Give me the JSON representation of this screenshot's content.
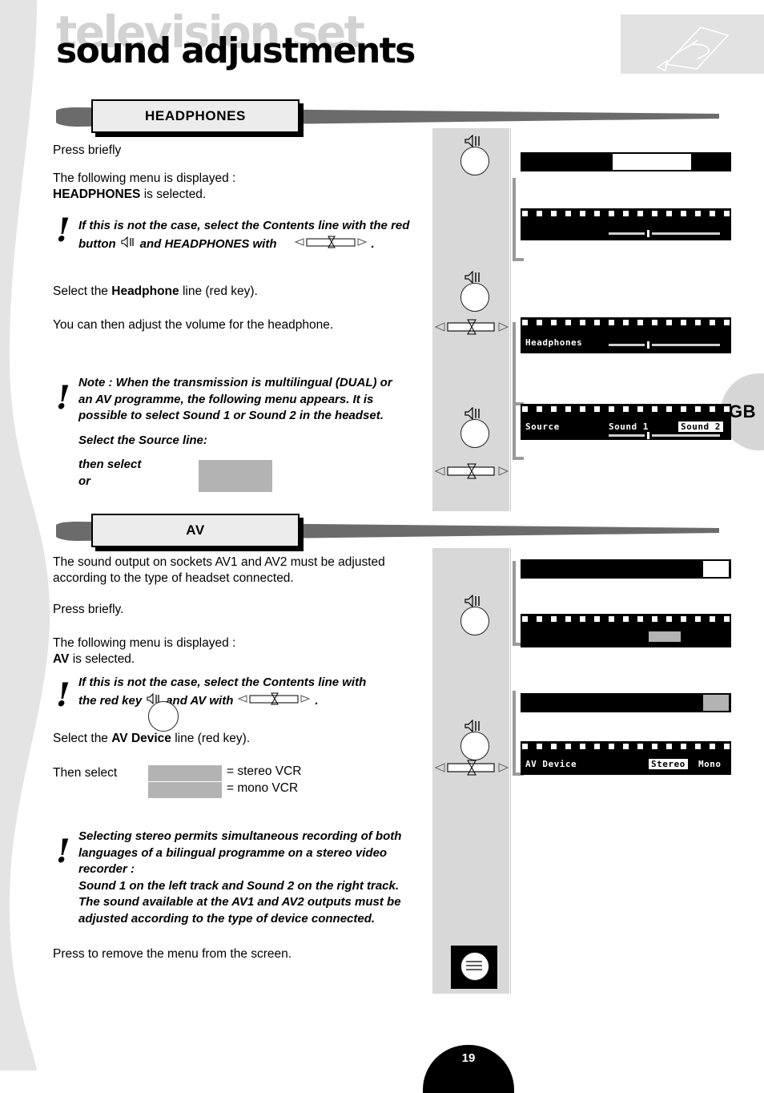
{
  "page": {
    "ghost_title": "television set",
    "title": "sound adjustments",
    "language_tab": "GB",
    "page_number": "19"
  },
  "sections": [
    {
      "id": "headphones",
      "header": "HEADPHONES",
      "paragraphs": [
        {
          "id": "p1",
          "text": "Press briefly"
        },
        {
          "id": "p2",
          "line1": "The following menu is displayed :",
          "line2_bold": "HEADPHONES",
          "line2_rest": " is selected."
        },
        {
          "id": "p3",
          "pre": "Select the ",
          "bold": "Headphone",
          "post": " line (red key)."
        },
        {
          "id": "p4",
          "text": "You can then adjust the volume for the headphone."
        }
      ],
      "notes": [
        {
          "id": "n1",
          "line1": "If this is not the case, select the Contents line with the red",
          "line2_a": "button",
          "line2_b": "and HEADPHONES with",
          "line2_c": "."
        },
        {
          "id": "n2",
          "line1": "Note : When the transmission is multilingual (DUAL) or",
          "line2": "an AV programme, the following menu appears. It is",
          "line3": "possible to select Sound 1 or Sound 2 in the headset.",
          "line4": "Select the Source line:",
          "line5": "then select",
          "line6": "or"
        }
      ],
      "screens": [
        {
          "id": "s1",
          "bar_highlight": "middle",
          "menu_labels": [],
          "has_slider": true
        },
        {
          "id": "s2",
          "menu_labels": [
            {
              "text": "Headphones",
              "inverted": false
            }
          ],
          "has_slider": true
        },
        {
          "id": "s3",
          "menu_labels": [
            {
              "text": "Source",
              "inverted": false
            },
            {
              "text": "Sound 1",
              "inverted": false
            },
            {
              "text": "Sound 2",
              "inverted": true
            }
          ],
          "has_slider": true
        }
      ],
      "keys": [
        "volume-key",
        "volume-key",
        "volume-key"
      ]
    },
    {
      "id": "av",
      "header": "AV",
      "paragraphs": [
        {
          "id": "p1",
          "line1": "The sound output on sockets AV1 and AV2 must be adjusted",
          "line2": "according to the type of headset connected."
        },
        {
          "id": "p2",
          "text": "Press briefly."
        },
        {
          "id": "p3",
          "line1": "The following menu is displayed :",
          "line2_bold": "AV",
          "line2_rest": " is selected."
        },
        {
          "id": "p4",
          "pre": "Select the ",
          "bold": "AV Device",
          "post": " line (red key)."
        },
        {
          "id": "p5",
          "text": "Then select"
        },
        {
          "id": "p6",
          "text": "Press to remove the menu from the screen."
        }
      ],
      "options": [
        {
          "label": "= stereo VCR"
        },
        {
          "label": "= mono VCR"
        }
      ],
      "notes": [
        {
          "id": "n1",
          "line1": "If this is not the case, select the Contents line with",
          "line2_a": "the red key",
          "line2_b": "and AV with",
          "line2_c": "."
        },
        {
          "id": "n2",
          "line1": "Selecting stereo permits simultaneous recording of both",
          "line2": "languages of a bilingual programme on a stereo video recorder :",
          "line3": "Sound 1 on the left track and Sound 2 on the right track.",
          "line4": "The sound available at the AV1 and AV2 outputs must be",
          "line5": "adjusted according to the type of device connected."
        }
      ],
      "screens": [
        {
          "id": "s1",
          "bar_highlight": "right-white",
          "menu_labels": [],
          "has_grey_box": true
        },
        {
          "id": "s2",
          "bar_highlight": "right-grey",
          "menu_labels": [
            {
              "text": "AV Device",
              "inverted": false
            },
            {
              "text": "Stereo",
              "inverted": true
            },
            {
              "text": "Mono",
              "inverted": false
            }
          ]
        }
      ],
      "keys": [
        "volume-key",
        "volume-key",
        "menu-key"
      ]
    }
  ],
  "icons": {
    "speaker": "speaker-icon",
    "rocker": "left-right-rocker-icon",
    "menu": "menu-lines-icon",
    "remote": "remote-control-icon",
    "exclamation": "!"
  },
  "colors": {
    "grey_column": "#d8d8d8",
    "wing": "#6b6b6b",
    "swatch": "#b3b3b3",
    "ghost_title": "#d2d2d2"
  }
}
